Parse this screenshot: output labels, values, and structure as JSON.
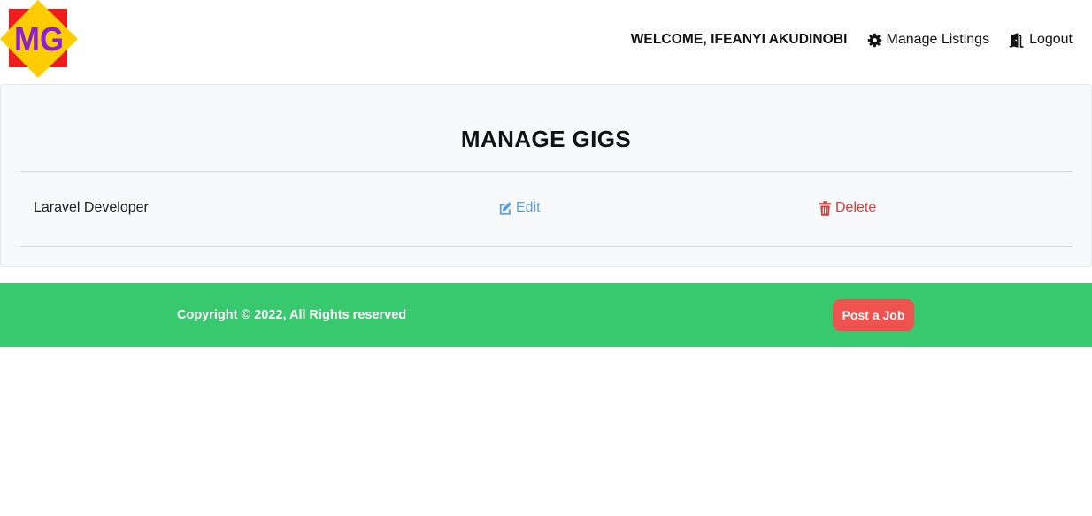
{
  "header": {
    "logo_text": "MG",
    "welcome": "WELCOME, IFEANYI AKUDINOBI",
    "manage_listings_label": "Manage Listings",
    "logout_label": "Logout"
  },
  "main": {
    "title": "MANAGE GIGS",
    "gigs": [
      {
        "title": "Laravel Developer",
        "edit_label": "Edit",
        "delete_label": "Delete"
      }
    ]
  },
  "footer": {
    "copyright": "Copyright © 2022, All Rights reserved",
    "post_job_label": "Post a Job"
  },
  "colors": {
    "footer_bg": "#38c96e",
    "post_job_bg": "#ef5350",
    "edit": "#5b9ee0",
    "delete": "#dc3b3b",
    "logo_square": "#ee1c1c",
    "logo_diamond": "#ffcc00",
    "logo_text": "#8a1fd6"
  },
  "icons": {
    "manage_listings": "gear-icon",
    "logout": "door-icon",
    "edit": "pencil-square-icon",
    "delete": "trash-icon"
  }
}
